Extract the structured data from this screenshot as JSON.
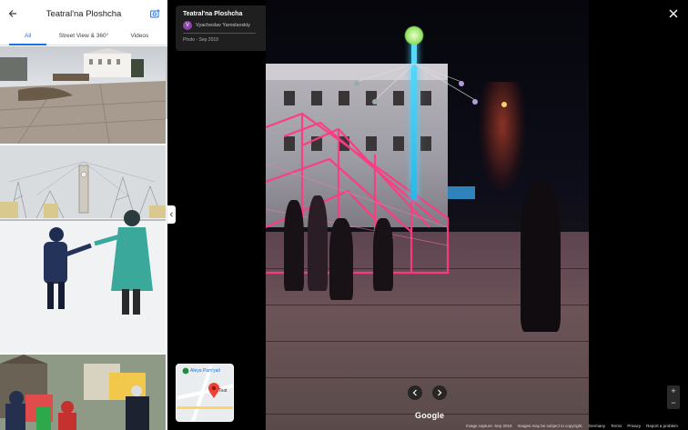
{
  "panel": {
    "title": "Teatral'na Ploshcha",
    "tabs": [
      {
        "label": "All",
        "active": true
      },
      {
        "label": "Street View & 360°",
        "active": false
      },
      {
        "label": "Videos",
        "active": false
      }
    ]
  },
  "info_card": {
    "title": "Teatral'na Ploshcha",
    "avatar_letter": "V",
    "user": "Vyacheslav Yaroslavskiy",
    "date": "Photo - Sep 2019"
  },
  "minimap": {
    "label_1": "Aleya Pam'yati",
    "label_2": "Teat"
  },
  "logo": "Google",
  "footer": {
    "capture": "Image capture: Sep 2019",
    "copyright": "Images may be subject to copyright.",
    "country": "Germany",
    "terms": "Terms",
    "privacy": "Privacy",
    "report": "Report a problem"
  },
  "zoom": {
    "in": "+",
    "out": "−"
  },
  "colors": {
    "accent": "#1a73e8",
    "card_bg": "#1f1f1f",
    "avatar": "#8e44ad"
  }
}
